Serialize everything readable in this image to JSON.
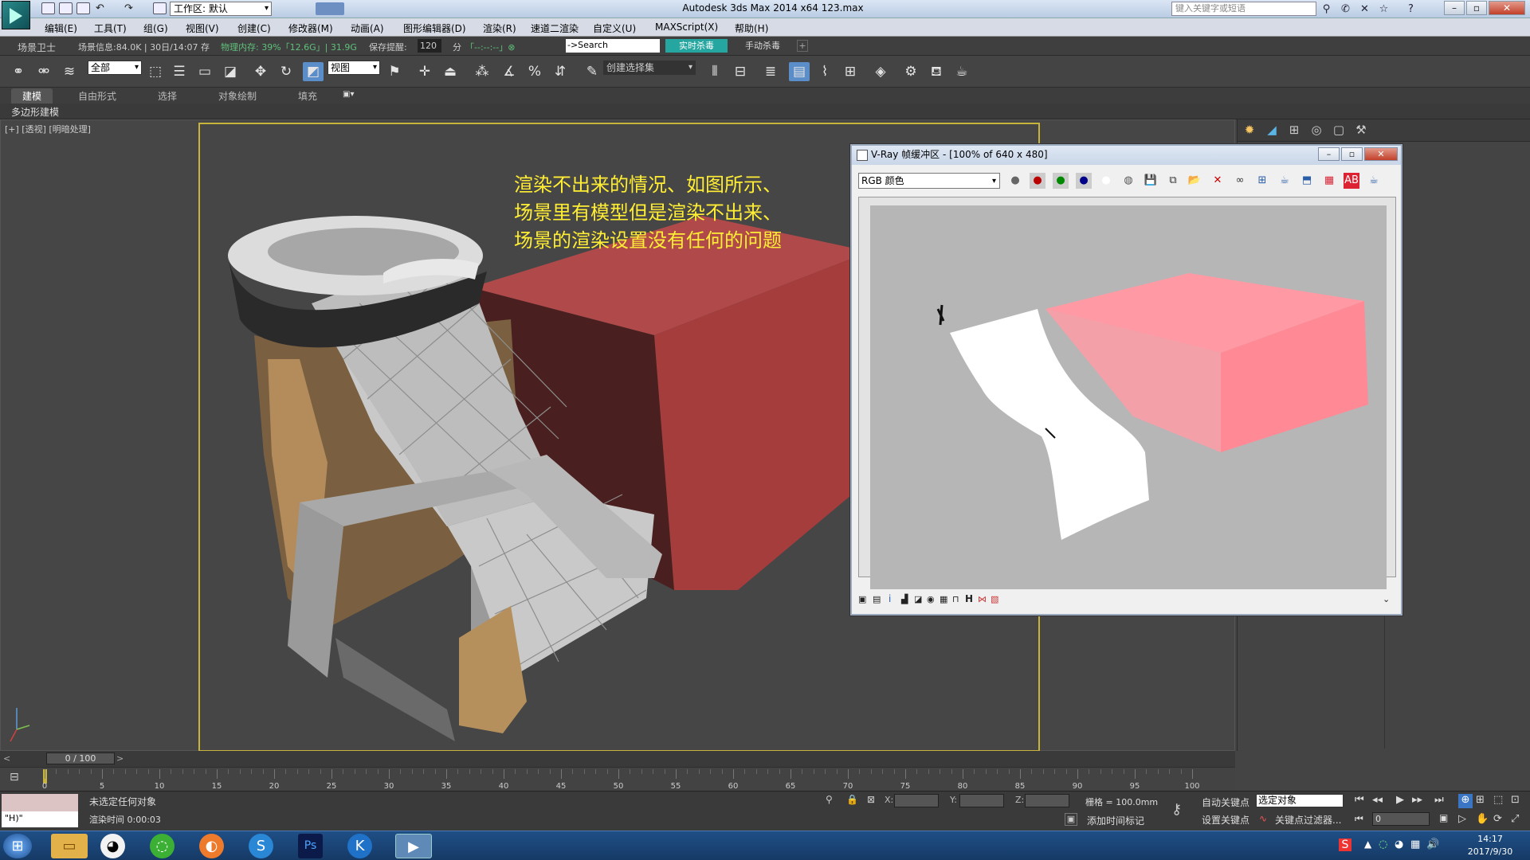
{
  "titlebar": {
    "workspace": "工作区: 默认",
    "app_title": "Autodesk 3ds Max  2014 x64      123.max",
    "search_placeholder": "键入关键字或短语"
  },
  "menu": [
    "编辑(E)",
    "工具(T)",
    "组(G)",
    "视图(V)",
    "创建(C)",
    "修改器(M)",
    "动画(A)",
    "图形编辑器(D)",
    "渲染(R)",
    "速道二渲染",
    "自定义(U)",
    "MAXScript(X)",
    "帮助(H)"
  ],
  "infobar": {
    "guard": "场景卫士",
    "scene_info": "场景信息:84.0K | 30日/14:07 存",
    "memory": "物理内存: 39%「12.6G」| 31.9G",
    "save_prompt": "保存提醒:",
    "save_value": "120",
    "minutes": "分",
    "search": "->Search",
    "realtime_kill": "实时杀毒",
    "manual_kill": "手动杀毒"
  },
  "toolbar": {
    "filter": "全部",
    "refcoord": "视图",
    "selset": "创建选择集"
  },
  "ribbon": {
    "tabs": [
      "建模",
      "自由形式",
      "选择",
      "对象绘制",
      "填充"
    ],
    "sub": "多边形建模"
  },
  "viewport": {
    "label": "[+] [透视] [明暗处理]",
    "annotation_lines": [
      "渲染不出来的情况、如图所示、",
      "场景里有模型但是渲染不出来、",
      "场景的渲染设置没有任何的问题"
    ]
  },
  "vray": {
    "title": "V-Ray 帧缓冲区 - [100% of 640 x 480]",
    "channel": "RGB 颜色"
  },
  "timeline": {
    "slider": "0 / 100",
    "ticks": [
      "0",
      "5",
      "10",
      "15",
      "20",
      "25",
      "30",
      "35",
      "40",
      "45",
      "50",
      "55",
      "60",
      "65",
      "70",
      "75",
      "80",
      "85",
      "90",
      "95",
      "100"
    ]
  },
  "status": {
    "maxscript": "\"H)\"",
    "selection": "未选定任何对象",
    "render_time": "渲染时间  0:00:03",
    "x_label": "X:",
    "y_label": "Y:",
    "z_label": "Z:",
    "grid": "栅格 = 100.0mm",
    "auto_key": "自动关键点",
    "set_key": "设置关键点",
    "selected_obj": "选定对象",
    "key_filters": "关键点过滤器...",
    "add_time_tag": "添加时间标记",
    "frame": "0"
  },
  "clock": {
    "time": "14:17",
    "date": "2017/9/30"
  },
  "colors": {
    "accent": "#25a6a0",
    "annotation": "#ffee33",
    "safe_frame": "#c8b43a",
    "box_red": "#a53d3d",
    "render_pink": "#ff9aa4"
  }
}
